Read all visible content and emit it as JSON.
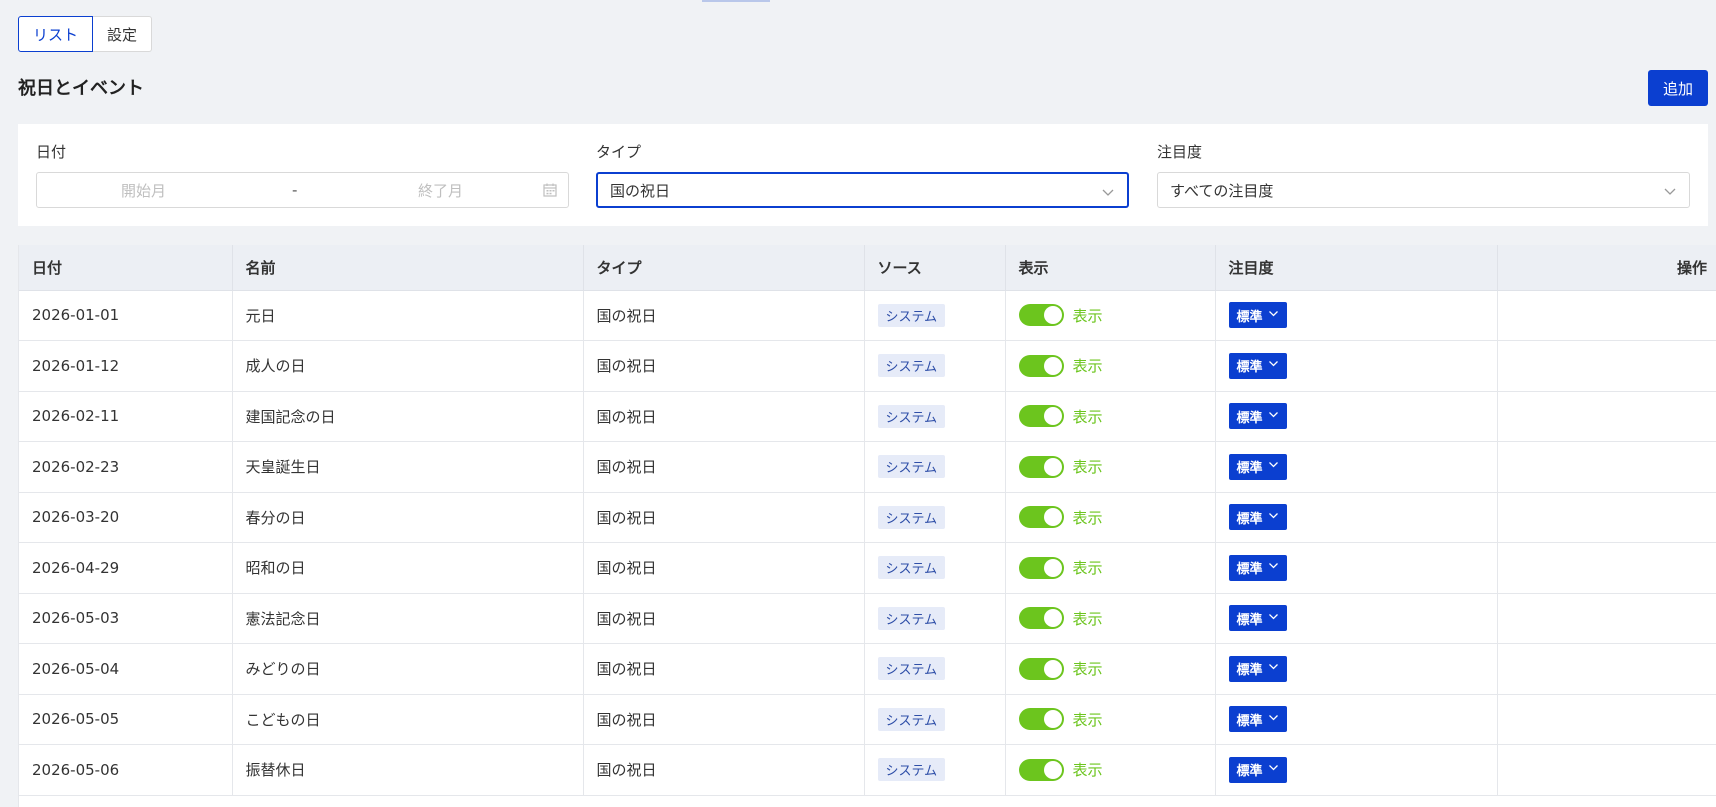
{
  "tabs": [
    {
      "label": "リスト",
      "active": true
    },
    {
      "label": "設定",
      "active": false
    }
  ],
  "page_title": "祝日とイベント",
  "add_button_label": "追加",
  "filters": {
    "date": {
      "label": "日付",
      "start_placeholder": "開始月",
      "separator": "-",
      "end_placeholder": "終了月"
    },
    "type": {
      "label": "タイプ",
      "value": "国の祝日"
    },
    "attention": {
      "label": "注目度",
      "value": "すべての注目度"
    }
  },
  "table": {
    "columns": [
      "日付",
      "名前",
      "タイプ",
      "ソース",
      "表示",
      "注目度",
      "操作"
    ],
    "rows": [
      {
        "date": "2026-01-01",
        "name": "元日",
        "type": "国の祝日",
        "source": "システム",
        "display": "表示",
        "attention": "標準"
      },
      {
        "date": "2026-01-12",
        "name": "成人の日",
        "type": "国の祝日",
        "source": "システム",
        "display": "表示",
        "attention": "標準"
      },
      {
        "date": "2026-02-11",
        "name": "建国記念の日",
        "type": "国の祝日",
        "source": "システム",
        "display": "表示",
        "attention": "標準"
      },
      {
        "date": "2026-02-23",
        "name": "天皇誕生日",
        "type": "国の祝日",
        "source": "システム",
        "display": "表示",
        "attention": "標準"
      },
      {
        "date": "2026-03-20",
        "name": "春分の日",
        "type": "国の祝日",
        "source": "システム",
        "display": "表示",
        "attention": "標準"
      },
      {
        "date": "2026-04-29",
        "name": "昭和の日",
        "type": "国の祝日",
        "source": "システム",
        "display": "表示",
        "attention": "標準"
      },
      {
        "date": "2026-05-03",
        "name": "憲法記念日",
        "type": "国の祝日",
        "source": "システム",
        "display": "表示",
        "attention": "標準"
      },
      {
        "date": "2026-05-04",
        "name": "みどりの日",
        "type": "国の祝日",
        "source": "システム",
        "display": "表示",
        "attention": "標準"
      },
      {
        "date": "2026-05-05",
        "name": "こどもの日",
        "type": "国の祝日",
        "source": "システム",
        "display": "表示",
        "attention": "標準"
      },
      {
        "date": "2026-05-06",
        "name": "振替休日",
        "type": "国の祝日",
        "source": "システム",
        "display": "表示",
        "attention": "標準"
      }
    ]
  },
  "colors": {
    "accent": "#0b3fd0",
    "toggle_on": "#6cc51e",
    "background": "#f0f2f5",
    "tag_bg": "#e6ebf8"
  },
  "icons": {
    "date_filter": "calendar-icon",
    "select": "chevron-down-icon",
    "attention_button": "chevron-down-icon"
  }
}
